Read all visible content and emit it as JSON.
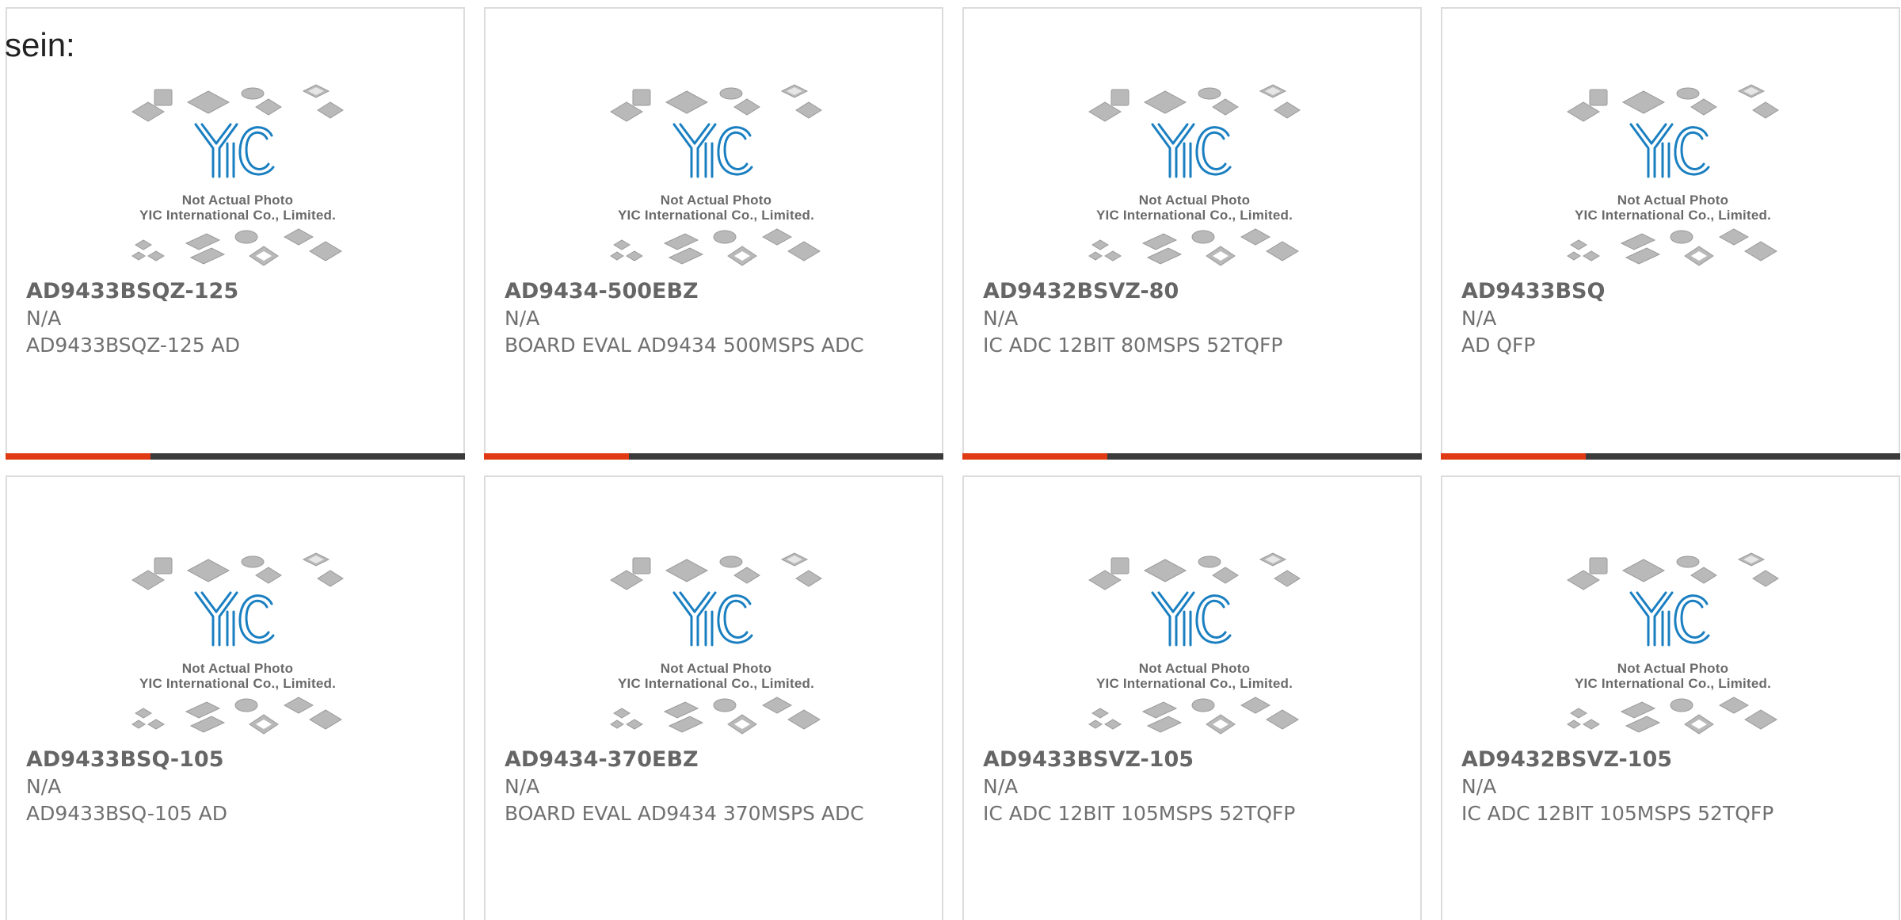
{
  "heading": "sein:",
  "placeholder_image": {
    "icon": "chip-packages-placeholder-icon",
    "logo": "YIC",
    "line1": "Not Actual Photo",
    "line2": "YIC International Co., Limited."
  },
  "colors": {
    "accent": "#e03a14",
    "bar": "#3b3b3b",
    "logo_blue": "#1a7fc1"
  },
  "products": [
    {
      "part_number": "AD9433BSQZ-125",
      "stock": "N/A",
      "description": "AD9433BSQZ-125 AD"
    },
    {
      "part_number": "AD9434-500EBZ",
      "stock": "N/A",
      "description": "BOARD EVAL AD9434 500MSPS ADC"
    },
    {
      "part_number": "AD9432BSVZ-80",
      "stock": "N/A",
      "description": "IC ADC 12BIT 80MSPS 52TQFP"
    },
    {
      "part_number": "AD9433BSQ",
      "stock": "N/A",
      "description": "AD QFP"
    },
    {
      "part_number": "AD9433BSQ-105",
      "stock": "N/A",
      "description": "AD9433BSQ-105 AD"
    },
    {
      "part_number": "AD9434-370EBZ",
      "stock": "N/A",
      "description": "BOARD EVAL AD9434 370MSPS ADC"
    },
    {
      "part_number": "AD9433BSVZ-105",
      "stock": "N/A",
      "description": "IC ADC 12BIT 105MSPS 52TQFP"
    },
    {
      "part_number": "AD9432BSVZ-105",
      "stock": "N/A",
      "description": "IC ADC 12BIT 105MSPS 52TQFP"
    }
  ]
}
